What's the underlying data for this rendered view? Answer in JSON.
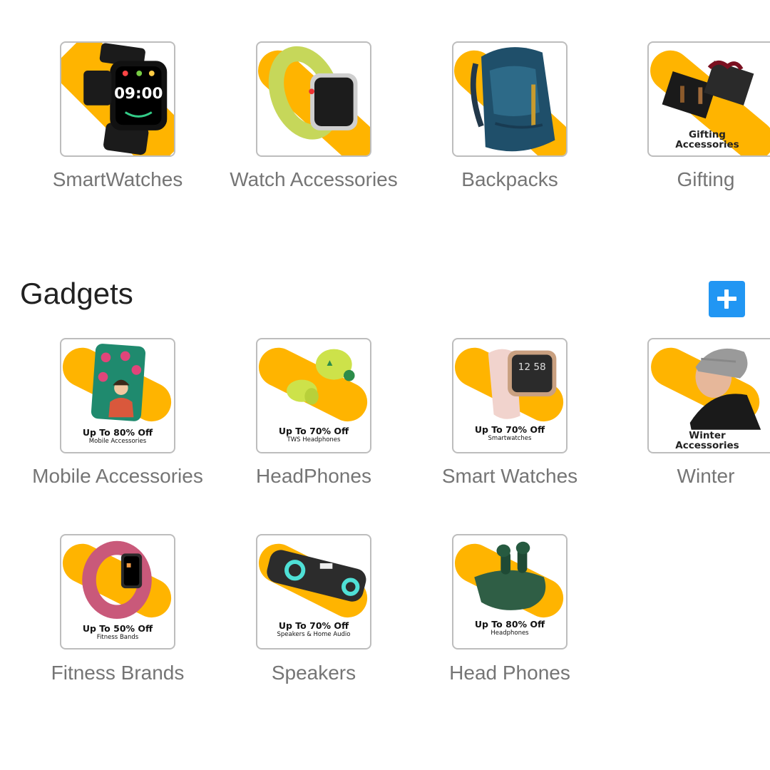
{
  "top_row": [
    {
      "label": "SmartWatches",
      "icon": "smartwatch-icon",
      "time": "09:00"
    },
    {
      "label": "Watch Accessories",
      "icon": "watch-strap-icon"
    },
    {
      "label": "Backpacks",
      "icon": "backpack-icon"
    },
    {
      "label": "Gifting",
      "icon": "gift-box-icon",
      "banner_line1": "Gifting",
      "banner_line2": "Accessories"
    }
  ],
  "gadgets": {
    "title": "Gadgets",
    "add_button_icon": "plus-icon",
    "items": [
      {
        "label": "Mobile Accessories",
        "icon": "phone-case-icon",
        "offer": "Up To 80% Off",
        "offer_sub": "Mobile Accessories"
      },
      {
        "label": "HeadPhones",
        "icon": "earbuds-icon",
        "offer": "Up To 70% Off",
        "offer_sub": "TWS Headphones"
      },
      {
        "label": "Smart Watches",
        "icon": "fitness-watch-icon",
        "offer": "Up To 70% Off",
        "offer_sub": "Smartwatches",
        "time": "12 58"
      },
      {
        "label": "Winter",
        "icon": "beanie-icon",
        "banner_line1": "Winter",
        "banner_line2": "Accessories"
      },
      {
        "label": "Fitness Brands",
        "icon": "fitness-band-icon",
        "offer": "Up To 50% Off",
        "offer_sub": "Fitness Bands"
      },
      {
        "label": "Speakers",
        "icon": "speaker-icon",
        "offer": "Up To 70% Off",
        "offer_sub": "Speakers & Home Audio"
      },
      {
        "label": "Head Phones",
        "icon": "earbuds-case-icon",
        "offer": "Up To 80% Off",
        "offer_sub": "Headphones"
      }
    ]
  },
  "colors": {
    "accent_blob": "#ffb400",
    "add_button": "#2196f3",
    "caption": "#757575",
    "title": "#212121",
    "tile_border": "#bdbdbd"
  }
}
